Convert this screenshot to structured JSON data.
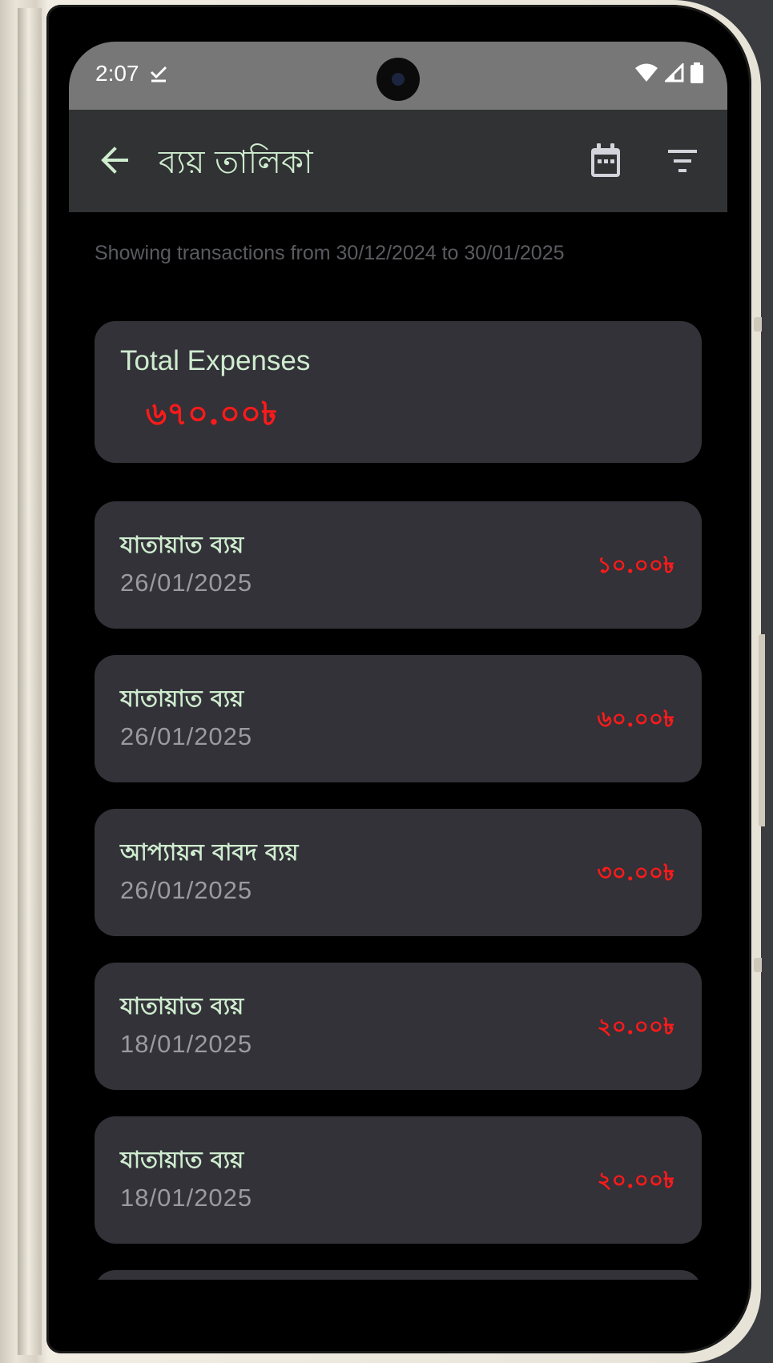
{
  "status_bar": {
    "time": "2:07"
  },
  "app_bar": {
    "title": "ব্যয় তালিকা"
  },
  "range_text": "Showing transactions from 30/12/2024 to 30/01/2025",
  "summary": {
    "label": "Total Expenses",
    "amount": "৬৭০.০০৳"
  },
  "transactions": [
    {
      "title": "যাতায়াত ব্যয়",
      "date": "26/01/2025",
      "amount": "১০.০০৳"
    },
    {
      "title": "যাতায়াত ব্যয়",
      "date": "26/01/2025",
      "amount": "৬০.০০৳"
    },
    {
      "title": "আপ্যায়ন বাবদ ব্যয়",
      "date": "26/01/2025",
      "amount": "৩০.০০৳"
    },
    {
      "title": "যাতায়াত ব্যয়",
      "date": "18/01/2025",
      "amount": "২০.০০৳"
    },
    {
      "title": "যাতায়াত ব্যয়",
      "date": "18/01/2025",
      "amount": "২০.০০৳"
    }
  ],
  "colors": {
    "accent_text": "#cfeccf",
    "expense_red": "#ff1a1a",
    "card_bg": "#323238",
    "app_bar_bg": "#303233"
  },
  "icons": {
    "back": "arrow-back-icon",
    "calendar": "calendar-icon",
    "filter": "filter-icon",
    "wifi": "wifi-icon",
    "signal": "signal-icon",
    "battery": "battery-icon",
    "check": "check-icon"
  }
}
